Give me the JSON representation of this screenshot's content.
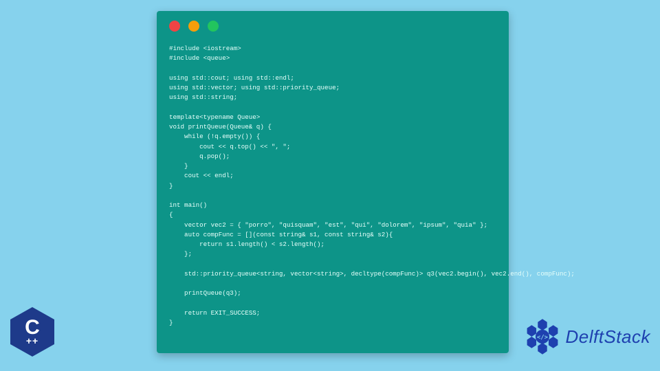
{
  "window": {
    "traffic_light_colors": {
      "red": "#ef4444",
      "yellow": "#f59e0b",
      "green": "#22c55e"
    },
    "code": "#include <iostream>\n#include <queue>\n\nusing std::cout; using std::endl;\nusing std::vector; using std::priority_queue;\nusing std::string;\n\ntemplate<typename Queue>\nvoid printQueue(Queue& q) {\n    while (!q.empty()) {\n        cout << q.top() << \", \";\n        q.pop();\n    }\n    cout << endl;\n}\n\nint main()\n{\n    vector vec2 = { \"porro\", \"quisquam\", \"est\", \"qui\", \"dolorem\", \"ipsum\", \"quia\" };\n    auto compFunc = [](const string& s1, const string& s2){\n        return s1.length() < s2.length();\n    };\n\n    std::priority_queue<string, vector<string>, decltype(compFunc)> q3(vec2.begin(), vec2.end(), compFunc);\n\n    printQueue(q3);\n\n    return EXIT_SUCCESS;\n}"
  },
  "cpp_badge": {
    "letter": "C",
    "suffix": "++"
  },
  "brand": {
    "name": "DelftStack"
  }
}
